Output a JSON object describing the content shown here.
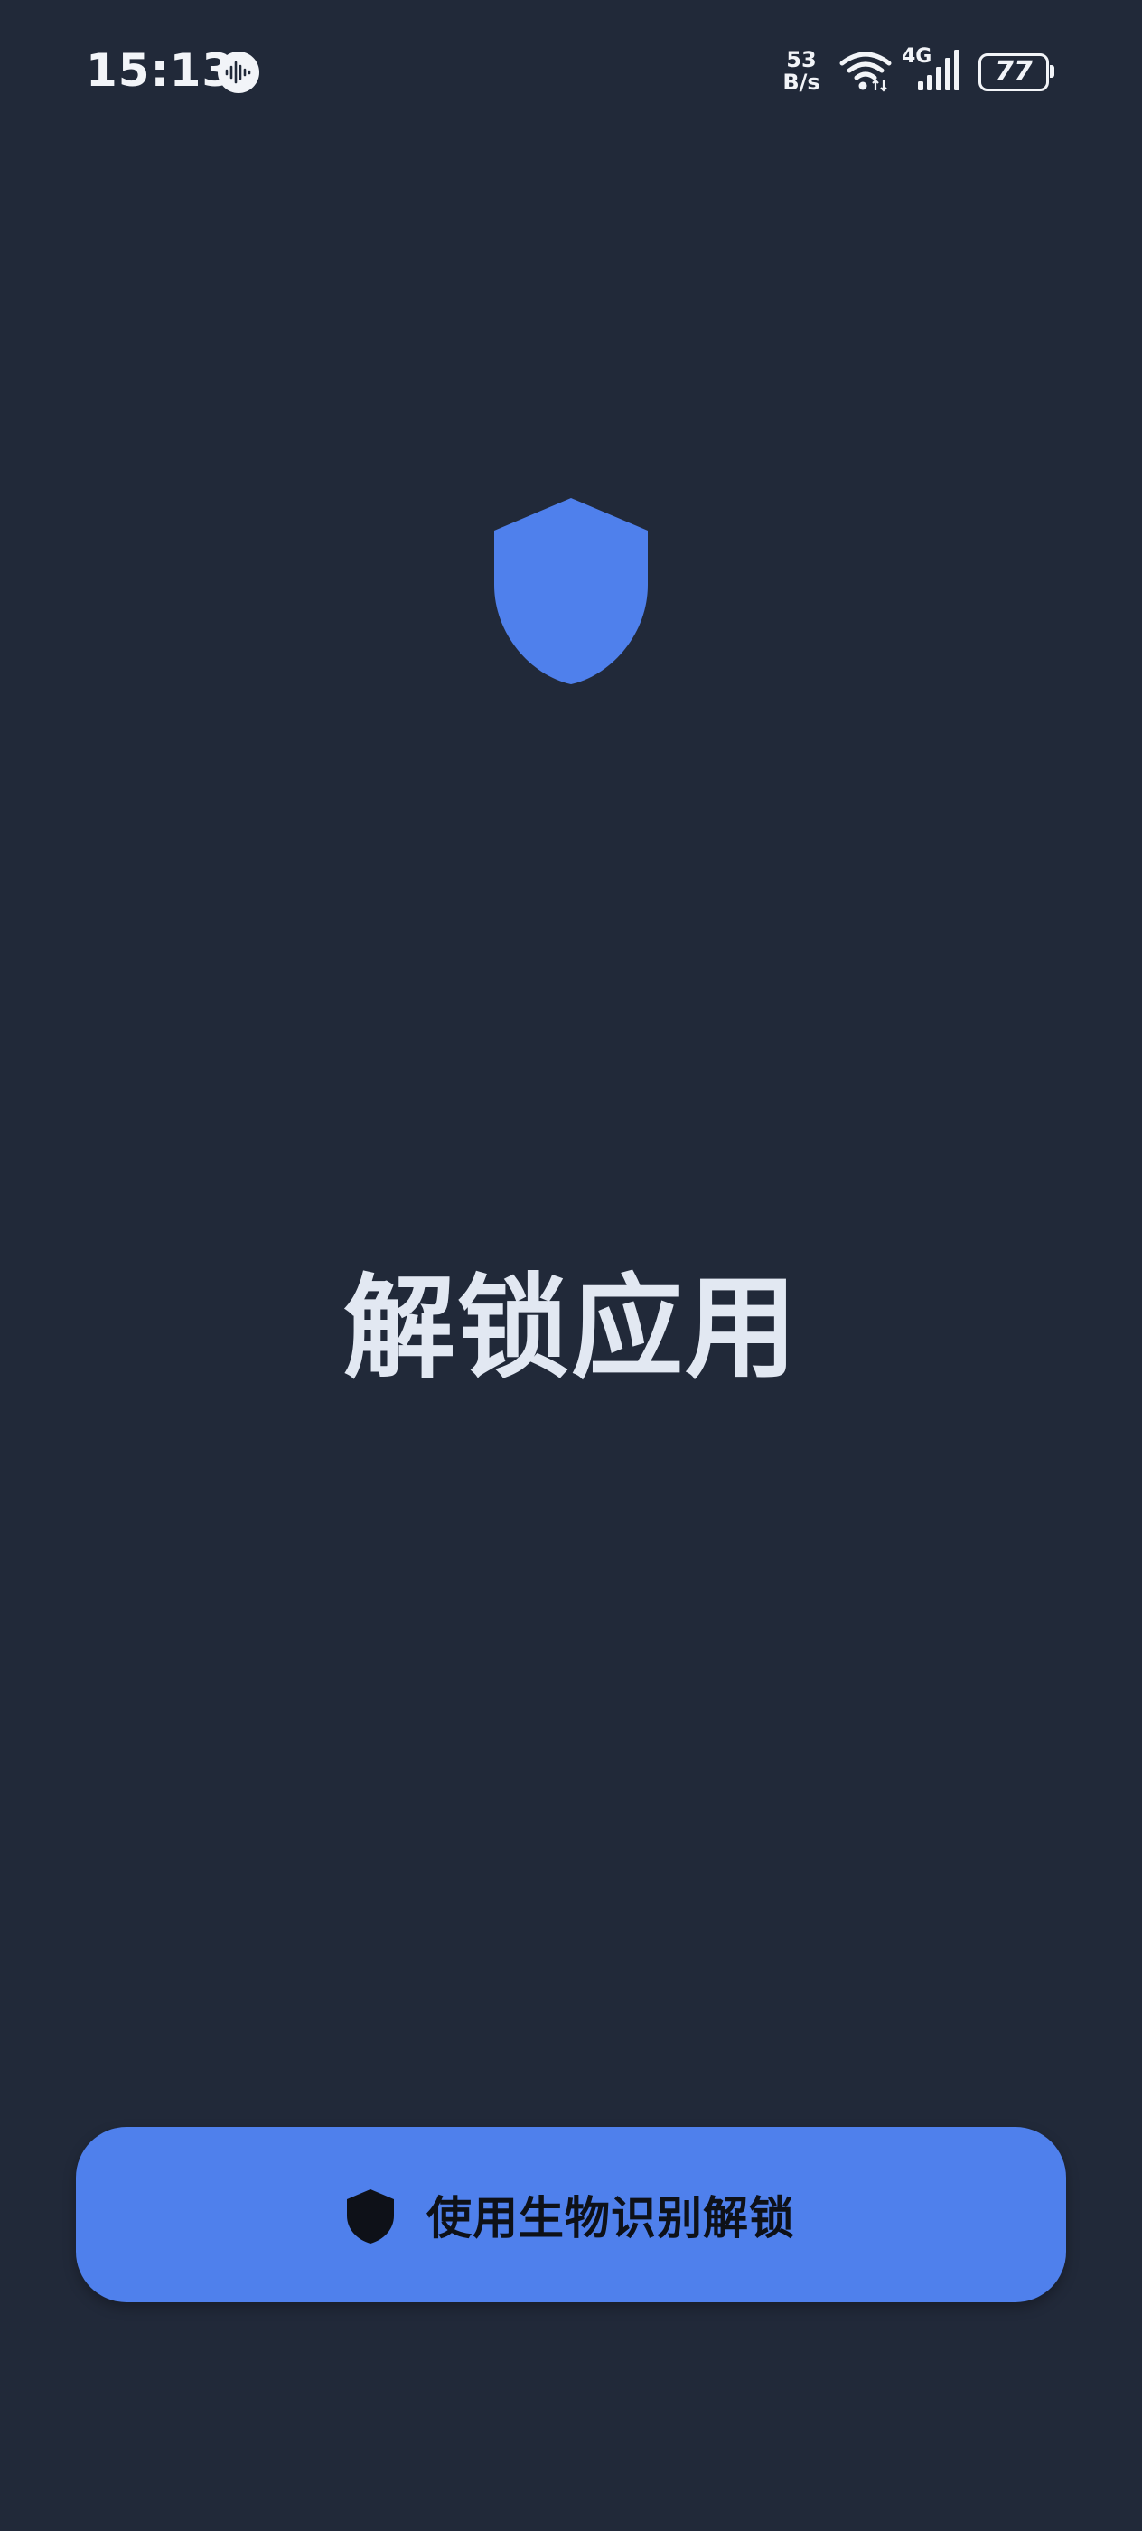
{
  "status_bar": {
    "time": "15:13",
    "net_speed_value": "53",
    "net_speed_unit": "B/s",
    "cell_type": "4G",
    "battery_level": "77",
    "icons": [
      "voice-assistant-icon",
      "wifi-icon",
      "cellular-signal-icon",
      "battery-icon"
    ]
  },
  "lock_screen": {
    "hero_icon": "shield-icon",
    "title": "解锁应用",
    "unlock_button": {
      "icon": "shield-icon",
      "label": "使用生物识别解锁"
    }
  },
  "colors": {
    "background": "#212939",
    "accent": "#4F80EC",
    "title_text": "#E2E8F2",
    "button_text": "#0E1118"
  }
}
